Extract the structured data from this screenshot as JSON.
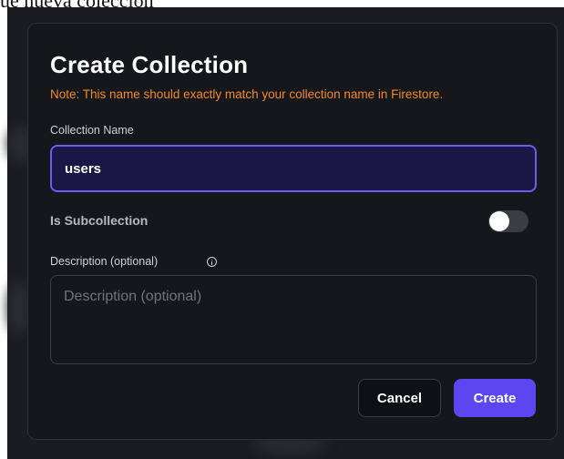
{
  "top_strip": {
    "text": "ue nueva colección"
  },
  "dialog": {
    "title": "Create Collection",
    "note": "Note: This name should exactly match your collection name in Firestore.",
    "collection_name": {
      "label": "Collection Name",
      "value": "users"
    },
    "subcollection": {
      "label": "Is Subcollection",
      "enabled": false
    },
    "description": {
      "label": "Description (optional)",
      "placeholder": "Description (optional)",
      "value": ""
    },
    "buttons": {
      "cancel": "Cancel",
      "create": "Create"
    }
  },
  "colors": {
    "dialog_bg": "#15171b",
    "note": "#f28a24",
    "accent": "#5b46f0",
    "input_focus_border": "#6b5cf3",
    "input_focus_bg": "#1a1645"
  },
  "icons": {
    "description_info": "info-icon"
  }
}
